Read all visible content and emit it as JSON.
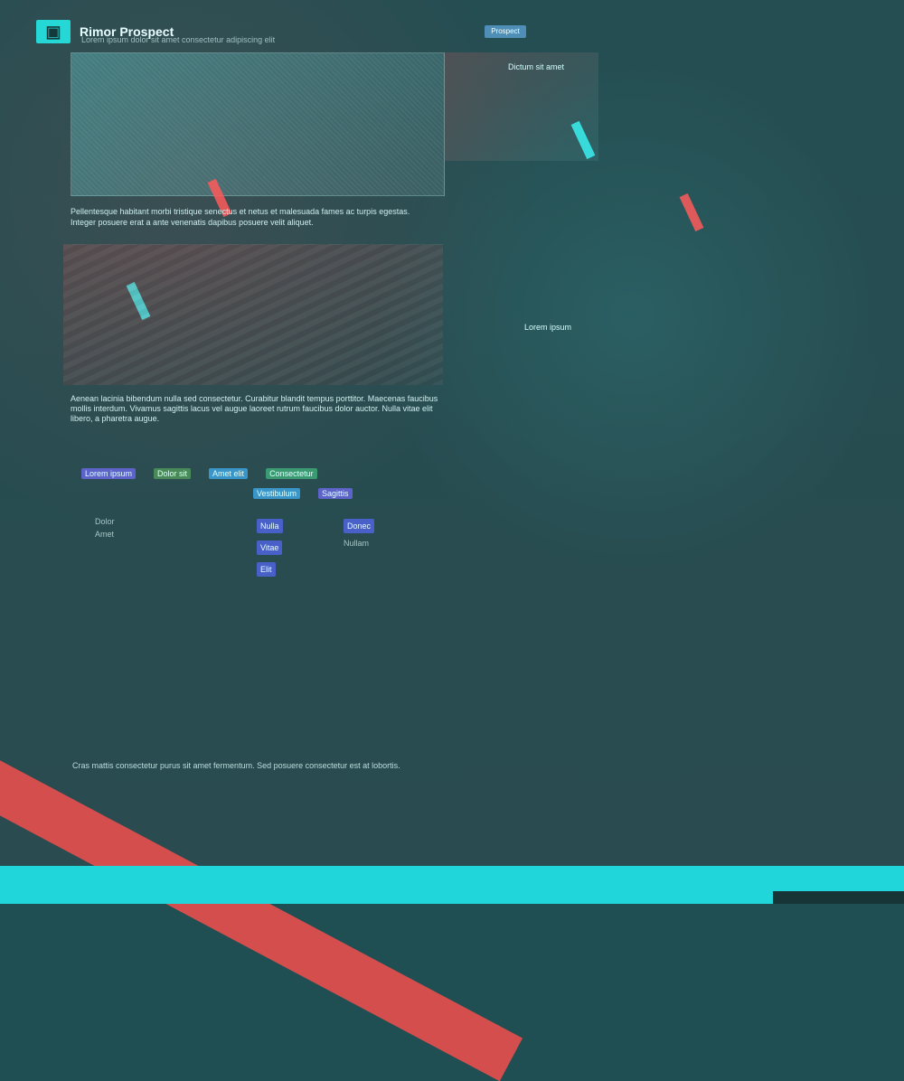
{
  "header": {
    "title": "Rimor Prospect",
    "subtitle": "Lorem ipsum dolor sit amet consectetur adipiscing elit"
  },
  "nav": {
    "chip": "Prospect",
    "links": [
      "",
      "",
      "",
      ""
    ]
  },
  "hero": {
    "side_title": "Dictum sit amet"
  },
  "intro": {
    "text": "Pellentesque habitant morbi tristique senectus et netus et malesuada fames ac turpis egestas. Integer posuere erat a ante venenatis dapibus posuere velit aliquet."
  },
  "diagram": {
    "label": "Lorem ipsum"
  },
  "body": {
    "text": "Aenean lacinia bibendum nulla sed consectetur. Curabitur blandit tempus porttitor. Maecenas faucibus mollis interdum. Vivamus sagittis lacus vel augue laoreet rutrum faucibus dolor auctor. Nulla vitae elit libero, a pharetra augue."
  },
  "tags": {
    "row1": [
      "Lorem ipsum",
      "Dolor sit",
      "Amet elit",
      "Consectetur"
    ],
    "row2": [
      "Vestibulum",
      "Sagittis"
    ]
  },
  "lists": {
    "left": [
      "Dolor",
      "Amet"
    ],
    "middle": [
      "Nulla",
      "Vitae",
      "Elit"
    ],
    "right": [
      "Donec",
      "Nullam"
    ]
  },
  "footer": {
    "text": "Cras mattis consectetur purus sit amet fermentum. Sed posuere consectetur est at lobortis."
  }
}
